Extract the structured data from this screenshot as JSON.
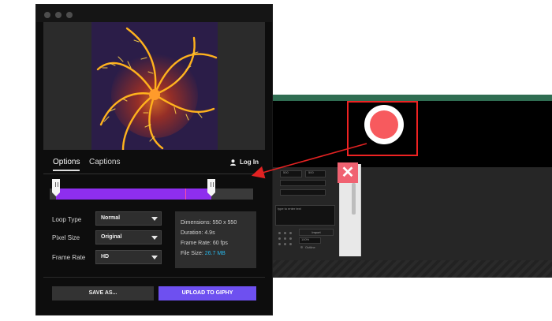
{
  "dialog": {
    "tabs": [
      {
        "label": "Options",
        "active": true
      },
      {
        "label": "Captions",
        "active": false
      }
    ],
    "login_label": "Log In",
    "settings": [
      {
        "label": "Loop Type",
        "value": "Normal"
      },
      {
        "label": "Pixel Size",
        "value": "Original"
      },
      {
        "label": "Frame Rate",
        "value": "HD"
      }
    ],
    "info": {
      "dimensions": "Dimensions: 550 x 550",
      "duration": "Duration: 4.9s",
      "frame_rate": "Frame Rate: 60 fps",
      "file_size_label": "File Size:",
      "file_size_value": "26.7 MB"
    },
    "trim": {
      "start_fraction": 0.0,
      "end_fraction": 0.78,
      "playhead_fraction": 0.63
    },
    "buttons": {
      "save": "SAVE AS...",
      "upload": "UPLOAD TO GIPHY"
    }
  },
  "background_app": {
    "field_1": "500",
    "field_2": "500",
    "zoom": "100%",
    "import_label": "Import",
    "outline_label": "Outline",
    "text_placeholder": "type to enter text"
  },
  "colors": {
    "accent_purple": "#8e2eee",
    "upload_button": "#6e50f0",
    "record": "#f75a5e",
    "callout_red": "#e22222",
    "close_button": "#f06271",
    "file_size_link": "#29b6e8"
  },
  "icons": [
    "user-icon",
    "record-icon",
    "close-icon",
    "chevron-down-icon"
  ]
}
